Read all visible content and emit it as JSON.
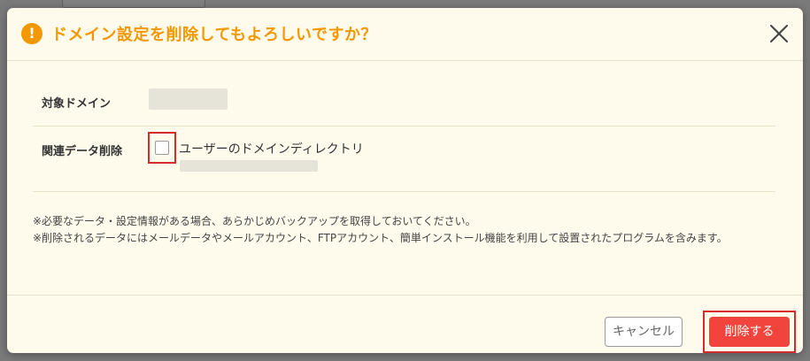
{
  "dialog": {
    "title": "ドメイン設定を削除してもよろしいですか？",
    "close_icon": "close-icon",
    "warning_icon": "exclamation-circle-icon",
    "warning_glyph": "!",
    "accent_color": "#f39800"
  },
  "fields": {
    "target_domain": {
      "label": "対象ドメイン",
      "value_masked": true
    },
    "related_data": {
      "label": "関連データ削除",
      "checkbox_label": "ユーザーのドメインディレクトリ",
      "checked": false,
      "path_masked": true
    }
  },
  "notes": [
    "※必要なデータ・設定情報がある場合、あらかじめバックアップを取得しておいてください。",
    "※削除されるデータにはメールデータやメールアカウント、FTPアカウント、簡単インストール機能を利用して設置されたプログラムを含みます。"
  ],
  "footer": {
    "cancel_label": "キャンセル",
    "delete_label": "削除する",
    "delete_color": "#f0443c"
  }
}
